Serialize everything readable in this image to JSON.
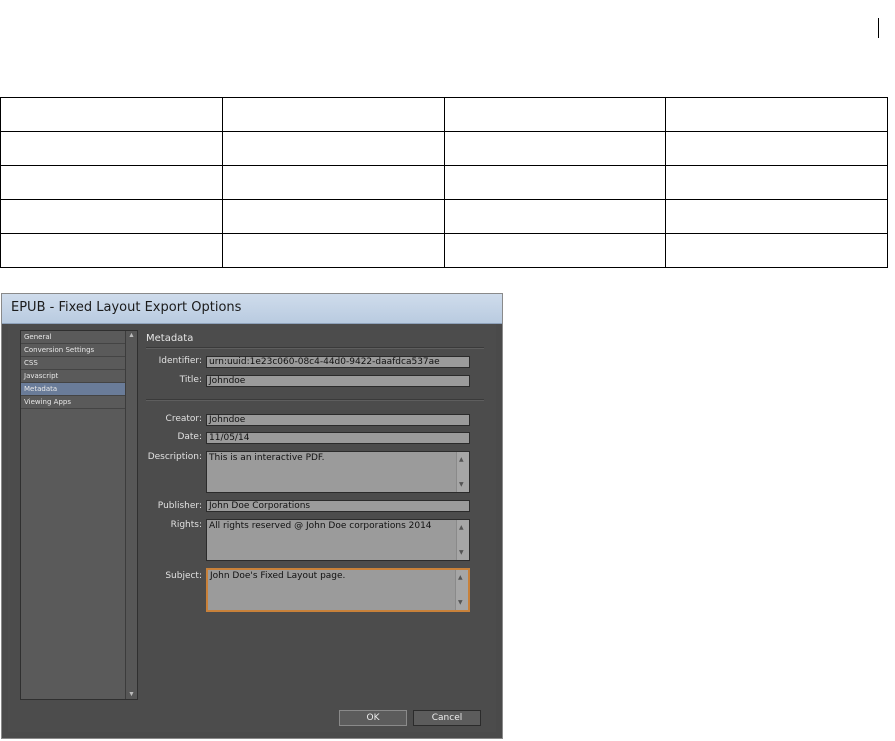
{
  "dialog": {
    "title": "EPUB - Fixed Layout Export Options",
    "sidebar": {
      "items": [
        {
          "label": "General"
        },
        {
          "label": "Conversion Settings"
        },
        {
          "label": "CSS"
        },
        {
          "label": "Javascript"
        },
        {
          "label": "Metadata",
          "selected": true
        },
        {
          "label": "Viewing Apps"
        }
      ]
    },
    "section_title": "Metadata",
    "fields": {
      "identifier": {
        "label": "Identifier:",
        "value": "urn:uuid:1e23c060-08c4-44d0-9422-daafdca537ae"
      },
      "title": {
        "label": "Title:",
        "value": "Johndoe"
      },
      "creator": {
        "label": "Creator:",
        "value": "Johndoe"
      },
      "date": {
        "label": "Date:",
        "value": "11/05/14"
      },
      "description": {
        "label": "Description:",
        "value": "This is an interactive PDF."
      },
      "publisher": {
        "label": "Publisher:",
        "value": "John Doe Corporations"
      },
      "rights": {
        "label": "Rights:",
        "value": "All rights reserved @ John Doe corporations 2014"
      },
      "subject": {
        "label": "Subject:",
        "value": "John Doe's Fixed Layout page."
      }
    },
    "buttons": {
      "ok": "OK",
      "cancel": "Cancel"
    }
  },
  "colors": {
    "focus_border": "#c8813a",
    "selected_item": "#6a7c99",
    "dialog_bg": "#4a4a4a"
  }
}
